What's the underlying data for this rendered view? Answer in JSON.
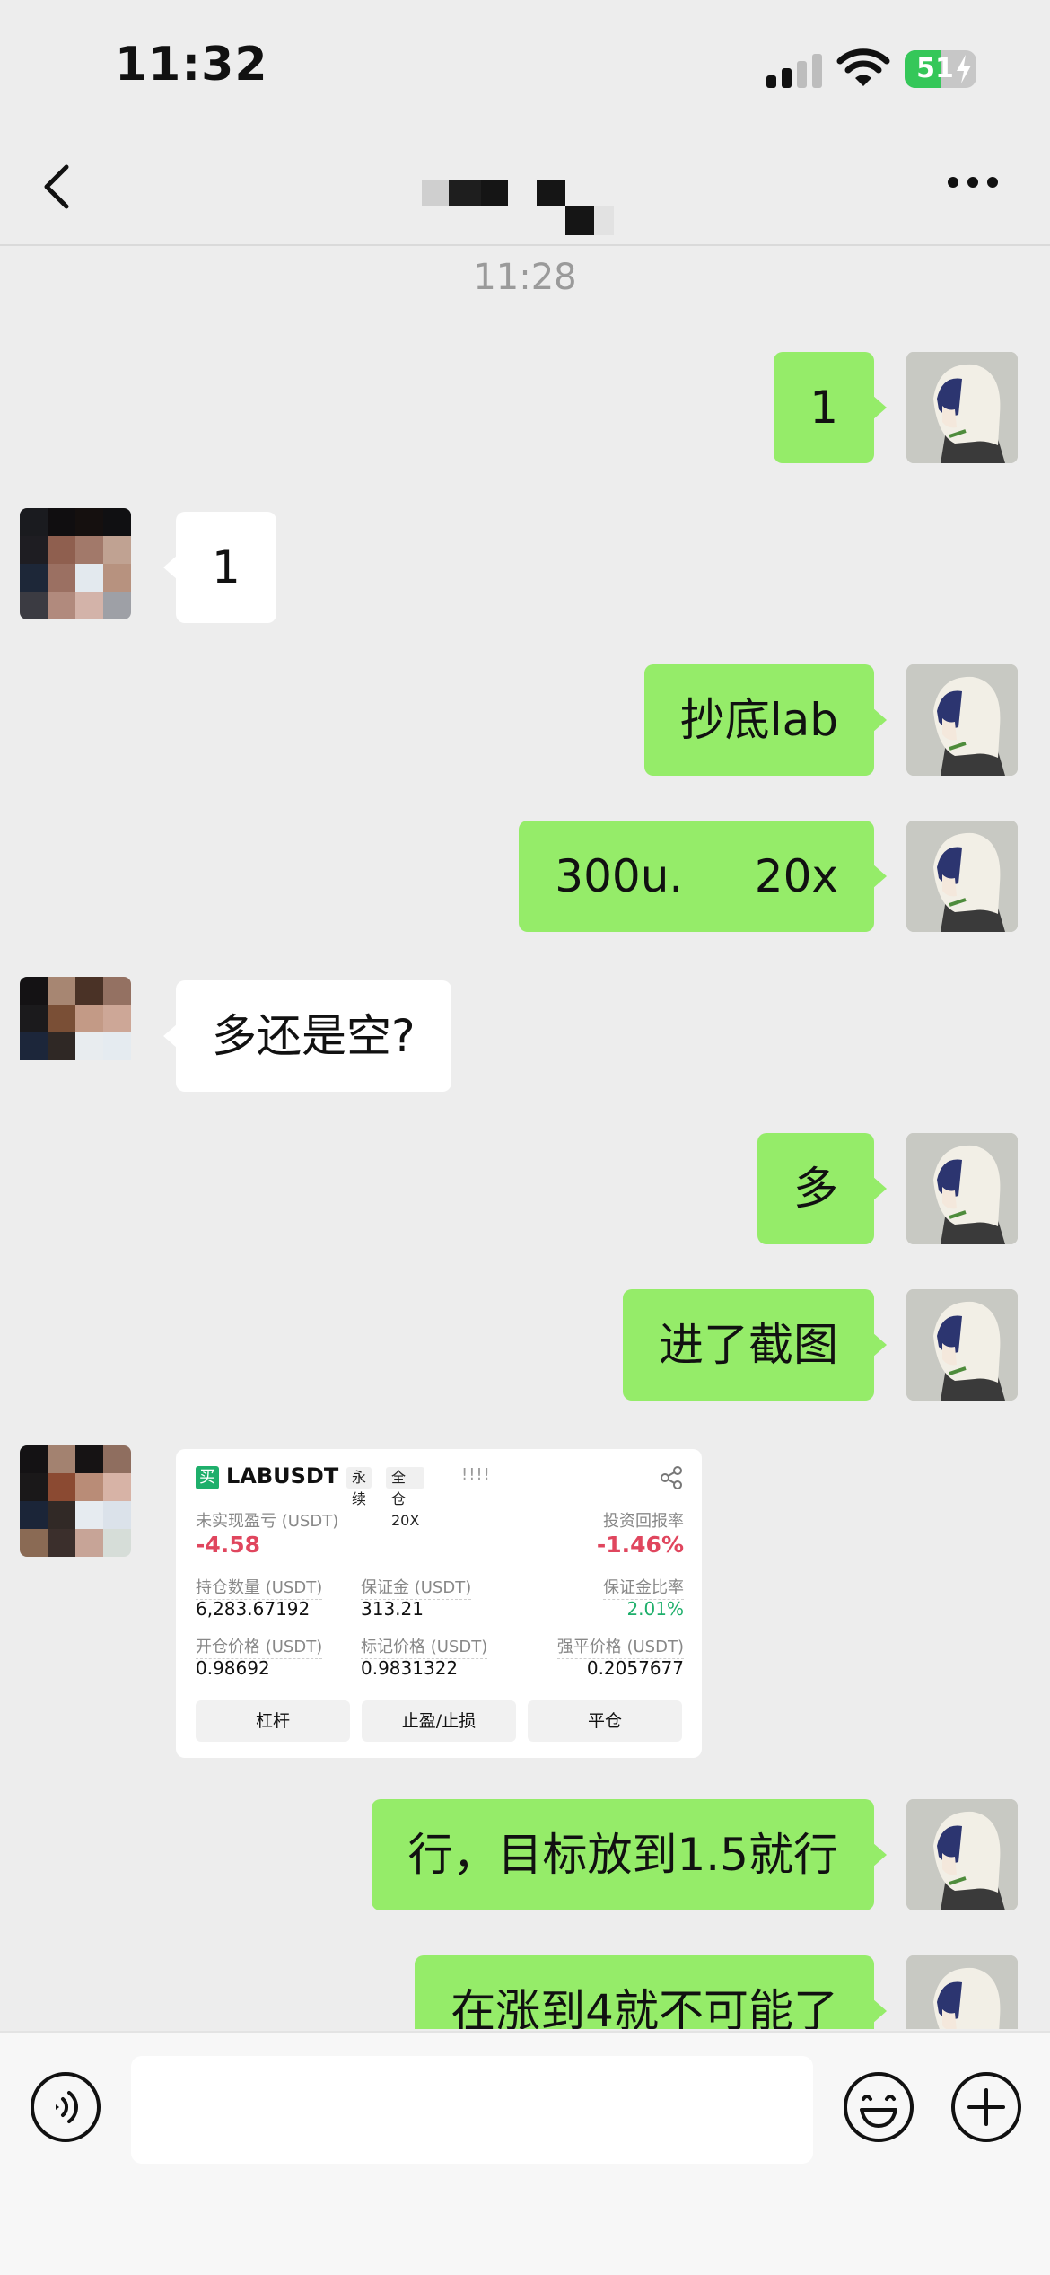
{
  "status_bar": {
    "time": "11:32",
    "battery": "51",
    "battery_level": 0.51
  },
  "nav": {
    "contact_name": ""
  },
  "chat": {
    "timestamp": "11:28",
    "messages": [
      {
        "from": "me",
        "text": "1"
      },
      {
        "from": "other",
        "text": "1"
      },
      {
        "from": "me",
        "text": "抄底lab"
      },
      {
        "from": "me",
        "text": "300u.     20x"
      },
      {
        "from": "other",
        "text": "多还是空?"
      },
      {
        "from": "me",
        "text": "多"
      },
      {
        "from": "me",
        "text": "进了截图"
      },
      {
        "from": "other",
        "type": "image"
      },
      {
        "from": "me",
        "text": "行，目标放到1.5就行"
      },
      {
        "from": "me",
        "text": "在涨到4就不可能了"
      }
    ]
  },
  "trade_card": {
    "side": "买",
    "pair": "LABUSDT",
    "type": "永续",
    "margin": "全仓 20X",
    "marks": "!!!!",
    "unrealized_pnl_label": "未实现盈亏 (USDT)",
    "unrealized_pnl": "-4.58",
    "roi_label": "投资回报率",
    "roi": "-1.46%",
    "position_label": "持仓数量 (USDT)",
    "position": "6,283.67192",
    "margin_label": "保证金 (USDT)",
    "margin_value": "313.21",
    "margin_ratio_label": "保证金比率",
    "margin_ratio": "2.01%",
    "entry_label": "开仓价格 (USDT)",
    "entry": "0.98692",
    "mark_label": "标记价格 (USDT)",
    "mark": "0.9831322",
    "liq_label": "强平价格 (USDT)",
    "liq": "0.2057677",
    "buttons": [
      "杠杆",
      "止盈/止损",
      "平仓"
    ]
  },
  "input_bar": {
    "placeholder": ""
  },
  "colors": {
    "my_bubble": "#95ec69",
    "other_bubble": "#ffffff",
    "background": "#ededed",
    "loss": "#e0465e",
    "gain": "#1eaf6b"
  }
}
